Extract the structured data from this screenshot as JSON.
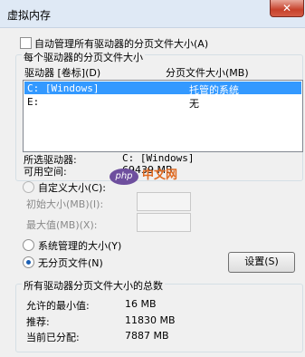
{
  "window": {
    "title": "虚拟内存",
    "close_icon": "✕"
  },
  "auto_manage": {
    "label": "自动管理所有驱动器的分页文件大小(A)",
    "checked": false
  },
  "per_drive": {
    "group_title": "每个驱动器的分页文件大小",
    "col_drive": "驱动器 [卷标](D)",
    "col_size": "分页文件大小(MB)",
    "rows": [
      {
        "drive": "C:   [Windows]",
        "size": "托管的系统"
      },
      {
        "drive": "E:",
        "size": "无"
      }
    ]
  },
  "selected": {
    "label": "所选驱动器:",
    "value": "C:  [Windows]",
    "space_label": "可用空间:",
    "space_value": "69439 MB"
  },
  "custom": {
    "label": "自定义大小(C):",
    "initial_label": "初始大小(MB)(I):",
    "initial_value": "",
    "max_label": "最大值(MB)(X):",
    "max_value": ""
  },
  "system_managed": {
    "label": "系统管理的大小(Y)"
  },
  "no_paging": {
    "label": "无分页文件(N)",
    "selected": true
  },
  "set_button": "设置(S)",
  "totals": {
    "group_title": "所有驱动器分页文件大小的总数",
    "min_label": "允许的最小值:",
    "min_value": "16 MB",
    "recommended_label": "推荐:",
    "recommended_value": "11830 MB",
    "current_label": "当前已分配:",
    "current_value": "7887 MB"
  },
  "watermark": {
    "logo": "php",
    "text": "中文网"
  }
}
